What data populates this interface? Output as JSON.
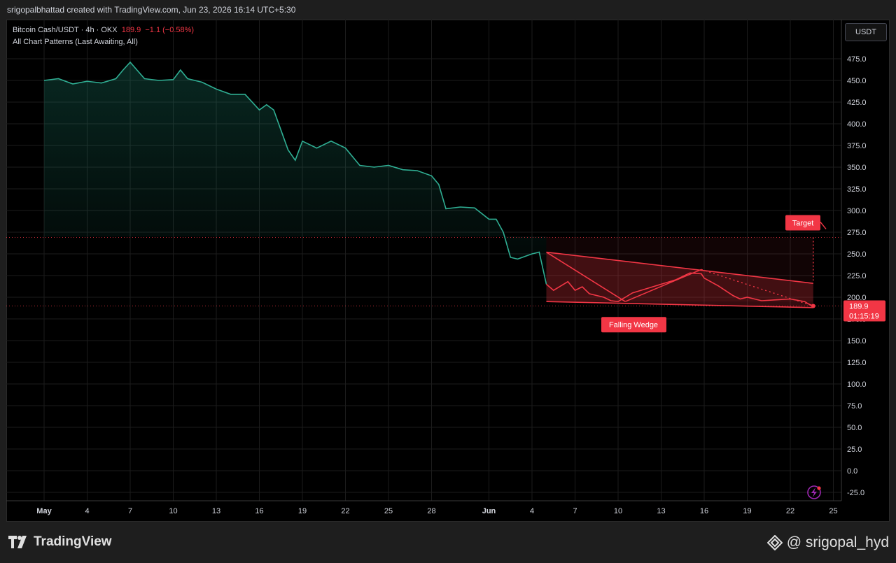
{
  "header": {
    "credit": "srigopalbhattad created with TradingView.com, Jun 23, 2026 16:14 UTC+5:30"
  },
  "legend": {
    "symbol": "Bitcoin Cash/USDT · 4h · OKX",
    "last": "189.9",
    "change": "−1.1 (−0.58%)",
    "indicator": "All Chart Patterns (Last Awaiting, All)"
  },
  "currency_button": "USDT",
  "price_label": {
    "price": "189.9",
    "countdown": "01:15:19"
  },
  "footer": {
    "brand": "TradingView",
    "watermark": "@ srigopal_hyd"
  },
  "colors": {
    "line": "#2fae93",
    "pattern": "#f23645",
    "background": "#000000",
    "axis_text": "#d1d4dc"
  },
  "chart_data": {
    "type": "line",
    "title": "Bitcoin Cash/USDT · 4h · OKX",
    "ylim": [
      -25,
      485
    ],
    "y_ticks": [
      475.0,
      450.0,
      425.0,
      400.0,
      375.0,
      350.0,
      325.0,
      300.0,
      275.0,
      250.0,
      225.0,
      200.0,
      175.0,
      150.0,
      125.0,
      100.0,
      75.0,
      50.0,
      25.0,
      0.0,
      -25.0
    ],
    "x_ticks": [
      "May",
      "4",
      "7",
      "10",
      "13",
      "16",
      "19",
      "22",
      "25",
      "28",
      "Jun",
      "4",
      "7",
      "10",
      "13",
      "16",
      "19",
      "22",
      "25"
    ],
    "x_tick_days": [
      1,
      4,
      7,
      10,
      13,
      16,
      19,
      22,
      25,
      28,
      32,
      35,
      38,
      41,
      44,
      47,
      50,
      53,
      56
    ],
    "series": [
      {
        "x": [
          1.0,
          2.0,
          3.0,
          4.0,
          5.0,
          6.0,
          6.5,
          7.0,
          8.0,
          9.0,
          10.0,
          10.5,
          11.0,
          12.0,
          13.0,
          14.0,
          15.0,
          16.0,
          16.5,
          17.0,
          18.0,
          18.5,
          19.0,
          20.0,
          21.0,
          22.0,
          23.0,
          24.0,
          25.0,
          26.0,
          27.0,
          28.0,
          28.5,
          29.0,
          30.0,
          31.0,
          32.0,
          32.5,
          33.0,
          33.5,
          34.0,
          35.0,
          35.5,
          36.0,
          36.5,
          37.0,
          37.5,
          38.0,
          38.5,
          39.0,
          40.0,
          40.5,
          41.0,
          41.5,
          42.0,
          43.0,
          44.0,
          45.0,
          46.0,
          46.8,
          47.0,
          48.0,
          49.0,
          49.5,
          50.0,
          51.0,
          52.0,
          53.0,
          54.0,
          54.3,
          54.6
        ],
        "values": [
          450,
          452,
          446,
          449,
          447,
          452,
          462,
          471,
          452,
          450,
          451,
          462,
          452,
          448,
          440,
          434,
          434,
          416,
          422,
          416,
          370,
          358,
          380,
          372,
          380,
          372,
          352,
          350,
          352,
          347,
          346,
          340,
          330,
          302,
          304,
          303,
          290,
          290,
          275,
          246,
          244,
          250,
          252,
          215,
          208,
          213,
          218,
          208,
          212,
          204,
          200,
          196,
          195,
          200,
          205,
          210,
          215,
          220,
          228,
          227,
          222,
          213,
          202,
          198,
          200,
          196,
          197,
          198,
          195,
          192,
          189.9
        ]
      }
    ],
    "pattern": {
      "name": "Falling Wedge",
      "target_label": "Target",
      "upper_line": [
        [
          36.0,
          252
        ],
        [
          54.6,
          216
        ]
      ],
      "lower_line": [
        [
          36.0,
          195
        ],
        [
          54.6,
          188
        ]
      ],
      "zigzag": [
        [
          36.0,
          252
        ],
        [
          41.5,
          195
        ],
        [
          46.8,
          232
        ],
        [
          54.6,
          189.9
        ]
      ],
      "target_level": 269,
      "last_price": 189.9
    }
  }
}
